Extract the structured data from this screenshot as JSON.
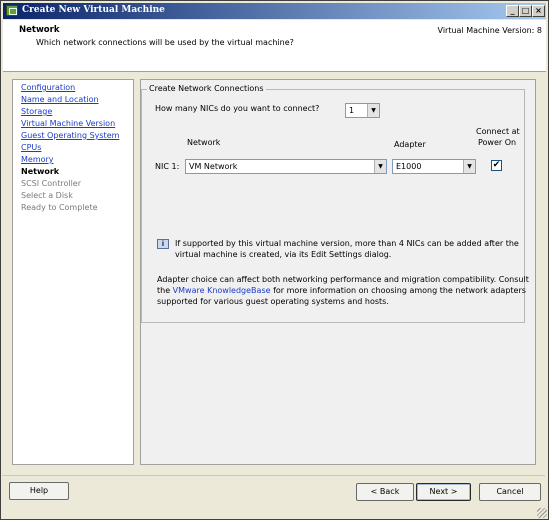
{
  "window": {
    "title": "Create New Virtual Machine",
    "controls": {
      "minimize": "_",
      "maximize": "□",
      "close": "×"
    }
  },
  "header": {
    "title": "Network",
    "subtitle": "Which network connections will be used by the virtual machine?",
    "version": "Virtual Machine Version: 8"
  },
  "sidebar": {
    "steps": [
      {
        "label": "Configuration",
        "state": "link"
      },
      {
        "label": "Name and Location",
        "state": "link"
      },
      {
        "label": "Storage",
        "state": "link"
      },
      {
        "label": "Virtual Machine Version",
        "state": "link"
      },
      {
        "label": "Guest Operating System",
        "state": "link"
      },
      {
        "label": "CPUs",
        "state": "link"
      },
      {
        "label": "Memory",
        "state": "link"
      },
      {
        "label": "Network",
        "state": "current"
      },
      {
        "label": "SCSI Controller",
        "state": "pending"
      },
      {
        "label": "Select a Disk",
        "state": "pending"
      },
      {
        "label": "Ready to Complete",
        "state": "pending"
      }
    ]
  },
  "network_panel": {
    "group_title": "Create Network Connections",
    "nic_question": "How many NICs do you want to connect?",
    "nic_count": "1",
    "col_network": "Network",
    "col_adapter": "Adapter",
    "col_connect_line1": "Connect at",
    "col_connect_line2": "Power On",
    "nic_label": "NIC 1:",
    "nic_network": "VM Network",
    "nic_adapter": "E1000",
    "nic_connect_checked": "✔",
    "info_icon": "info-icon",
    "info_line1": "If supported by this virtual machine version, more than 4 NICs can be added after the",
    "info_line2": "virtual machine is created, via its Edit Settings dialog.",
    "note_line1": "Adapter choice can affect both networking performance and migration compatibility. Consult",
    "note_line2_pre": "the ",
    "note_link": "VMware KnowledgeBase",
    "note_line2_post": " for more information on choosing among the network adapters",
    "note_line3": "supported for various guest operating systems and hosts."
  },
  "buttons": {
    "help": "Help",
    "back": "< Back",
    "next": "Next >",
    "cancel": "Cancel"
  },
  "colors": {
    "link": "#1a3cc8",
    "titlebar_start": "#0a246a",
    "titlebar_end": "#a6caf0",
    "pending": "#7a7a7a"
  }
}
